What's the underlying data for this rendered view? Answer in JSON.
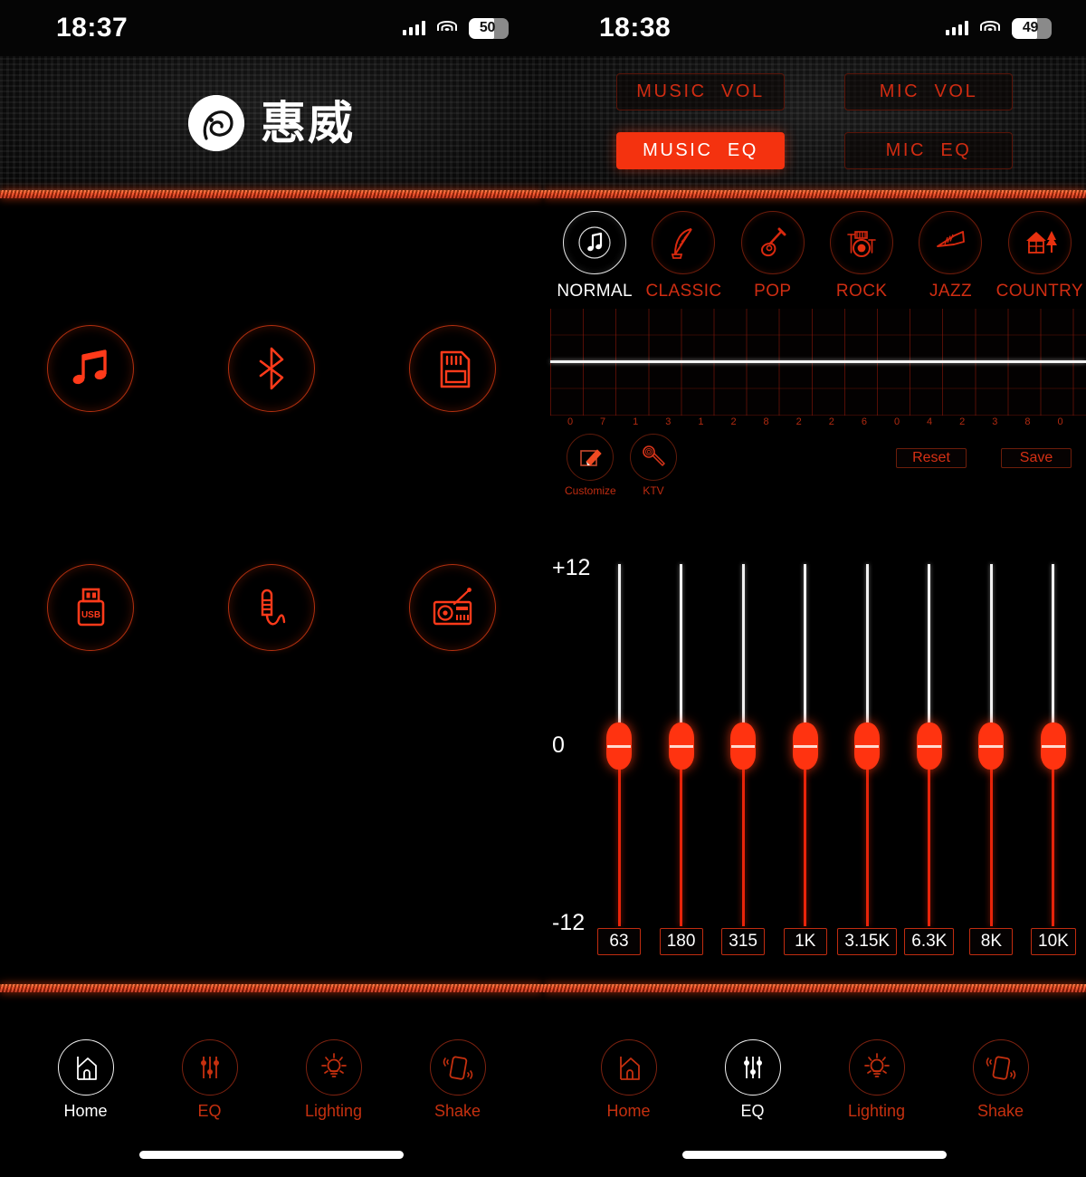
{
  "theme": {
    "accent": "#ff3a1a",
    "accent_dim": "#c02c10",
    "active_fill": "#f4320f",
    "white": "#ffffff"
  },
  "left": {
    "status": {
      "time": "18:37",
      "battery_level": "50",
      "signal_icon": "cellular-signal-icon",
      "wifi_icon": "wifi-icon",
      "battery_icon": "battery-icon"
    },
    "brand": {
      "logo_icon": "hivi-bird-logo-icon",
      "name": "惠威"
    },
    "sources": [
      {
        "id": "music",
        "icon": "music-note-icon",
        "label": "Music"
      },
      {
        "id": "bluetooth",
        "icon": "bluetooth-icon",
        "label": "Bluetooth"
      },
      {
        "id": "sdcard",
        "icon": "sd-card-icon",
        "label": "SD Card"
      },
      {
        "id": "usb",
        "icon": "usb-drive-icon",
        "label": "USB"
      },
      {
        "id": "aux",
        "icon": "aux-jack-icon",
        "label": "AUX"
      },
      {
        "id": "radio",
        "icon": "radio-icon",
        "label": "Radio"
      }
    ],
    "tabs": [
      {
        "label": "Home",
        "icon": "home-icon",
        "active": true
      },
      {
        "label": "EQ",
        "icon": "equalizer-icon",
        "active": false
      },
      {
        "label": "Lighting",
        "icon": "lightbulb-icon",
        "active": false
      },
      {
        "label": "Shake",
        "icon": "shake-phone-icon",
        "active": false
      }
    ]
  },
  "right": {
    "status": {
      "time": "18:38",
      "battery_level": "49",
      "signal_icon": "cellular-signal-icon",
      "wifi_icon": "wifi-icon",
      "battery_icon": "battery-icon"
    },
    "mode_buttons": [
      {
        "label": "MUSIC  VOL",
        "active": false
      },
      {
        "label": "MIC  VOL",
        "active": false
      },
      {
        "label": "MUSIC  EQ",
        "active": true
      },
      {
        "label": "MIC  EQ",
        "active": false
      }
    ],
    "presets": [
      {
        "label": "NORMAL",
        "icon": "music-note-icon",
        "active": true
      },
      {
        "label": "CLASSIC",
        "icon": "harp-icon",
        "active": false
      },
      {
        "label": "POP",
        "icon": "acoustic-guitar-icon",
        "active": false
      },
      {
        "label": "ROCK",
        "icon": "drum-kit-icon",
        "active": false
      },
      {
        "label": "JAZZ",
        "icon": "trumpet-icon",
        "active": false
      },
      {
        "label": "COUNTRY",
        "icon": "house-tree-icon",
        "active": false
      }
    ],
    "tools": [
      {
        "label": "Customize",
        "icon": "pencil-edit-icon"
      },
      {
        "label": "KTV",
        "icon": "microphone-icon"
      }
    ],
    "actions": [
      {
        "label": "Reset",
        "name": "reset-button"
      },
      {
        "label": "Save",
        "name": "save-button"
      }
    ],
    "scale": {
      "top": "+12",
      "mid": "0",
      "bottom": "-12"
    },
    "tabs": [
      {
        "label": "Home",
        "icon": "home-icon",
        "active": false
      },
      {
        "label": "EQ",
        "icon": "equalizer-icon",
        "active": true
      },
      {
        "label": "Lighting",
        "icon": "lightbulb-icon",
        "active": false
      },
      {
        "label": "Shake",
        "icon": "shake-phone-icon",
        "active": false
      }
    ]
  },
  "chart_data": {
    "type": "line",
    "title": "",
    "xlabel": "",
    "ylabel": "",
    "grid": true,
    "ylim": [
      -12,
      12
    ],
    "graph_tick_labels": [
      "0",
      "7",
      "1",
      "3",
      "1",
      "2",
      "8",
      "2",
      "2",
      "6",
      "0",
      "4",
      "2",
      "3",
      "8",
      "0"
    ],
    "curve_values": [
      0,
      0,
      0,
      0,
      0,
      0,
      0,
      0,
      0,
      0,
      0,
      0,
      0,
      0,
      0,
      0
    ],
    "legend": [],
    "bands": [
      {
        "label": "63",
        "value": 0
      },
      {
        "label": "180",
        "value": 0
      },
      {
        "label": "315",
        "value": 0
      },
      {
        "label": "1K",
        "value": 0
      },
      {
        "label": "3.15K",
        "value": 0
      },
      {
        "label": "6.3K",
        "value": 0
      },
      {
        "label": "8K",
        "value": 0
      },
      {
        "label": "10K",
        "value": 0
      }
    ]
  }
}
